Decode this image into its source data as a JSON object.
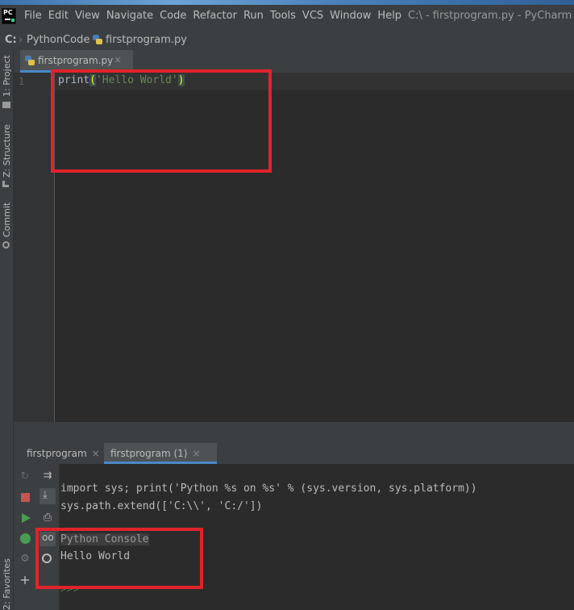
{
  "app": {
    "window_title": "C:\\ - firstprogram.py - PyCharm",
    "logo_text": "PC"
  },
  "menu": [
    "File",
    "Edit",
    "View",
    "Navigate",
    "Code",
    "Refactor",
    "Run",
    "Tools",
    "VCS",
    "Window",
    "Help"
  ],
  "breadcrumb": {
    "drive": "C:",
    "folder": "PythonCode",
    "file": "firstprogram.py"
  },
  "left_tool_windows": [
    "1: Project",
    "Z: Structure",
    "Commit",
    "2: Favorites"
  ],
  "editor": {
    "tab_label": "firstprogram.py",
    "line_number": "1",
    "code": {
      "func": "print",
      "open": "(",
      "string": "'Hello World'",
      "close": ")"
    }
  },
  "run_panel": {
    "tabs": [
      "firstprogram",
      "firstprogram (1)"
    ],
    "active_tab": 1,
    "console_lines": [
      "import sys; print('Python %s on %s' % (sys.version, sys.platform))",
      "sys.path.extend(['C:\\\\', 'C:/'])"
    ],
    "console_title": "Python Console",
    "output": "Hello World",
    "prompt": ">>>"
  },
  "colors": {
    "accent": "#4a88c7",
    "highlight_box": "#e0232b",
    "string": "#6a8759"
  }
}
